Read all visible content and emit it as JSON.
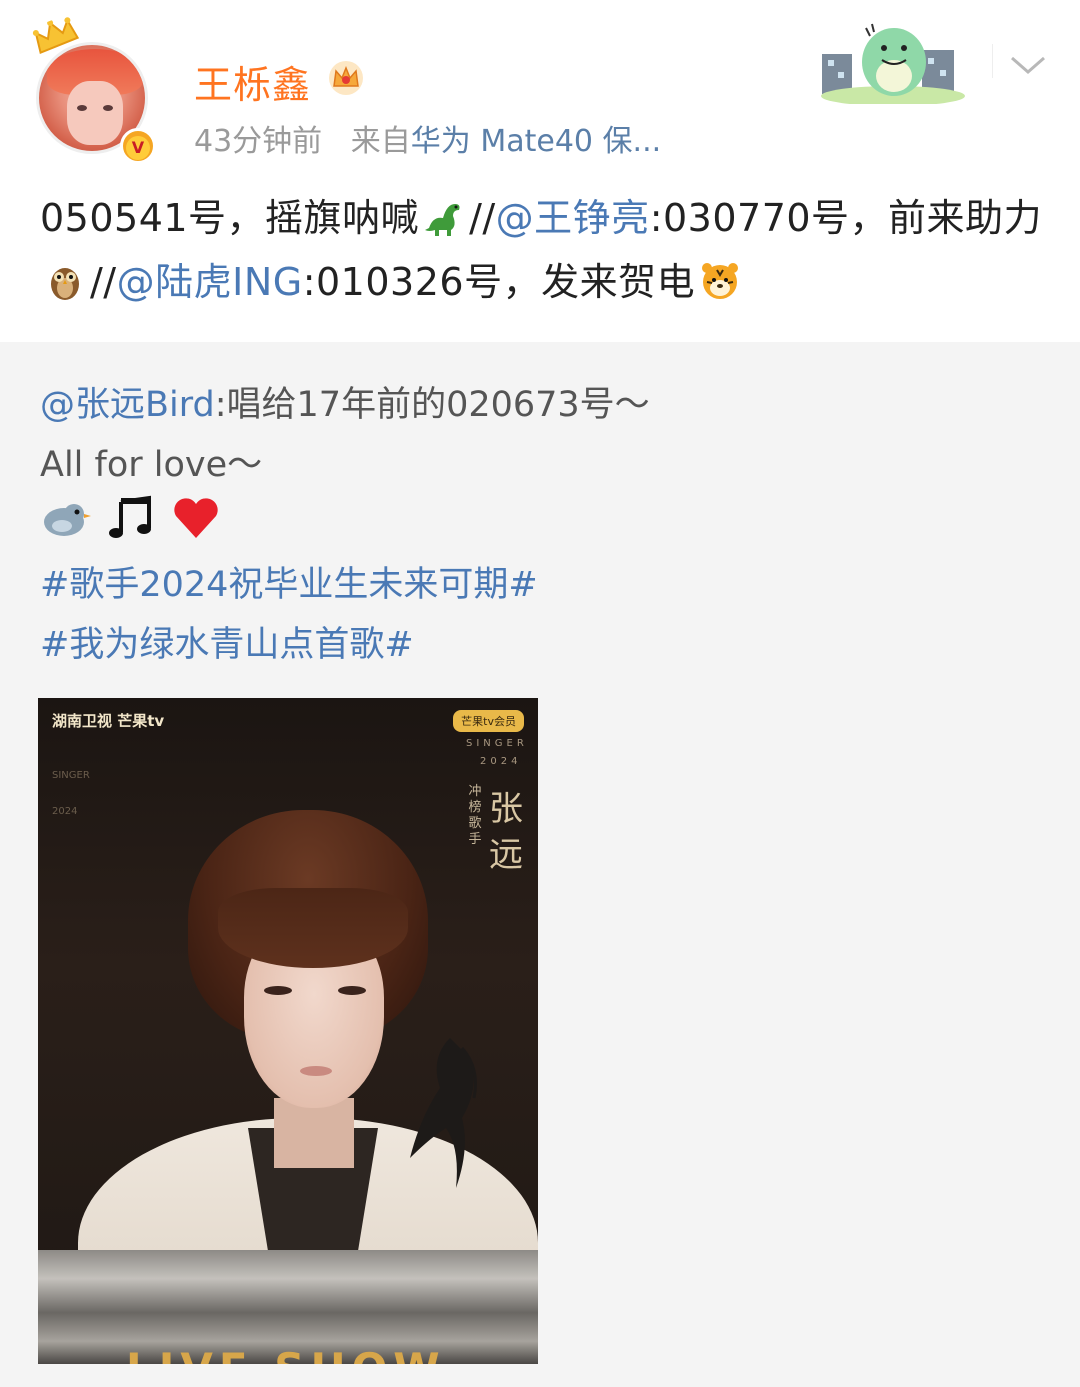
{
  "post": {
    "username": "王栎鑫",
    "time": "43分钟前",
    "source_prefix": "来自",
    "device": "华为 Mate40 保...",
    "text": {
      "part1": "050541号，摇旗呐喊",
      "sep1": "//",
      "mention1": "@王铮亮",
      "part2": ":030770号，前来助力",
      "sep2": "//",
      "mention2": "@陆虎ING",
      "part3": ":010326号，发来贺电"
    },
    "icons": {
      "crown": "crown-icon",
      "verify": "verified-badge-icon",
      "vip": "vip-crown-icon",
      "sticker": "dinosaur-sticker",
      "menu": "chevron-down-icon",
      "emoji1": "dinosaur-emoji",
      "emoji2": "owl-emoji",
      "emoji3": "tiger-emoji"
    }
  },
  "repost": {
    "mention": "@张远Bird",
    "text1": ":唱给17年前的020673号～",
    "text2": "All for love～",
    "emojis": [
      "bird-emoji",
      "music-note-emoji",
      "heart-emoji"
    ],
    "hashtag1": "#歌手2024祝毕业生未来可期#",
    "hashtag2": "#我为绿水青山点首歌#",
    "image": {
      "logo_left": "湖南卫视 芒果tv",
      "logo_right": "芒果tv会员",
      "singer_label": "SINGER",
      "year_label": "2024",
      "role": "冲榜歌手",
      "name": "张远",
      "side_text": "SINGER 2024",
      "bottom_text": "LIVE SHOW"
    }
  },
  "colors": {
    "username": "#ff7420",
    "link": "#4a79b5",
    "meta": "#9a9a9a",
    "repost_bg": "#f4f4f4"
  }
}
